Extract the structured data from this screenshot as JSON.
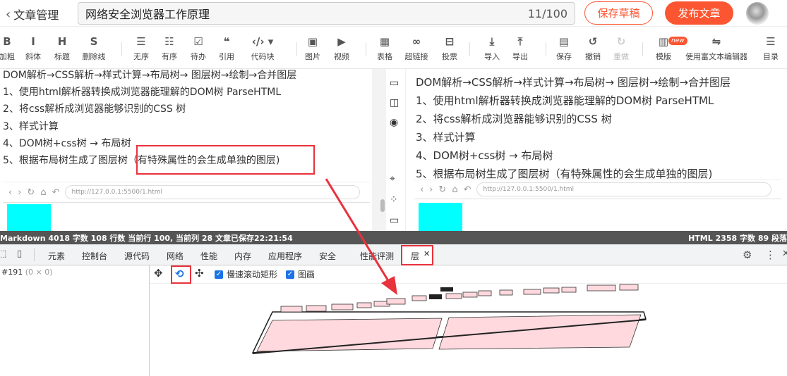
{
  "header": {
    "back_label": "文章管理",
    "title_value": "网络安全浏览器工作原理",
    "title_count": "11/100",
    "save_draft": "保存草稿",
    "publish": "发布文章"
  },
  "toolbar": {
    "items": [
      {
        "icon": "bold-icon",
        "glyph": "B",
        "label": "加粗"
      },
      {
        "icon": "italic-icon",
        "glyph": "I",
        "label": "斜体"
      },
      {
        "icon": "heading-icon",
        "glyph": "H",
        "label": "标题"
      },
      {
        "icon": "strikethrough-icon",
        "glyph": "S",
        "label": "删除线"
      },
      {
        "icon": "unordered-list-icon",
        "glyph": "☰",
        "label": "无序"
      },
      {
        "icon": "ordered-list-icon",
        "glyph": "☷",
        "label": "有序"
      },
      {
        "icon": "todo-list-icon",
        "glyph": "☑",
        "label": "待办"
      },
      {
        "icon": "quote-icon",
        "glyph": "❝",
        "label": "引用"
      },
      {
        "icon": "code-block-icon",
        "glyph": "‹/› ▾",
        "label": "代码块"
      },
      {
        "icon": "image-icon",
        "glyph": "▣",
        "label": "图片"
      },
      {
        "icon": "video-icon",
        "glyph": "▶",
        "label": "视频"
      },
      {
        "icon": "table-icon",
        "glyph": "▦",
        "label": "表格"
      },
      {
        "icon": "link-icon",
        "glyph": "∞",
        "label": "超链接"
      },
      {
        "icon": "vote-icon",
        "glyph": "⊟",
        "label": "投票"
      },
      {
        "icon": "import-icon",
        "glyph": "⤓",
        "label": "导入"
      },
      {
        "icon": "export-icon",
        "glyph": "⤒",
        "label": "导出"
      },
      {
        "icon": "save-icon",
        "glyph": "▤",
        "label": "保存"
      },
      {
        "icon": "undo-icon",
        "glyph": "↺",
        "label": "撤销"
      },
      {
        "icon": "redo-icon",
        "glyph": "↻",
        "label": "重做"
      },
      {
        "icon": "template-icon",
        "glyph": "▥",
        "label": "模版"
      },
      {
        "icon": "rich-editor-icon",
        "glyph": "⇋",
        "label": "使用富文本编辑器"
      },
      {
        "icon": "toc-icon",
        "glyph": "☰",
        "label": "目录"
      }
    ],
    "new_badge": "new"
  },
  "editor": {
    "lines": [
      "DOM解析→CSS解析→样式计算→布局树→ 图层树→绘制→合并图层",
      "1、使用html解析器转换成浏览器能理解的DOM树  ParseHTML",
      "2、将css解析成浏览器能够识别的CSS 树",
      "3、样式计算",
      "4、DOM树+css树 → 布局树",
      "5、根据布局树生成了图层树（有特殊属性的会生成单独的图层)"
    ],
    "mini_url": "http://127.0.0.1:5500/1.html"
  },
  "preview": {
    "lines": [
      "DOM解析→CSS解析→样式计算→布局树→ 图层树→绘制→合并图层",
      "1、使用html解析器转换成浏览器能理解的DOM树 ParseHTML",
      "2、将css解析成浏览器能够识别的CSS 树",
      "3、样式计算",
      "4、DOM树+css树 → 布局树",
      "5、根据布局树生成了图层树（有特殊属性的会生成单独的图层)"
    ],
    "mini_url": "http://127.0.0.1:5500/1.html"
  },
  "status": {
    "left": "Markdown  4018 字数  108 行数  当前行 100, 当前列 28  文章已保存22:21:54",
    "right": "HTML  2358 字数  89 段落"
  },
  "devtools": {
    "tabs": [
      "元素",
      "控制台",
      "源代码",
      "网络",
      "性能",
      "内存",
      "应用程序",
      "安全",
      "性能评测",
      "层"
    ],
    "active_tab": "层",
    "node_id": "#191",
    "node_size": "(0 × 0)",
    "slow_scroll_label": "慢速滚动矩形",
    "paint_label": "图画"
  },
  "colors": {
    "accent": "#fc5531",
    "highlight": "#e8323c",
    "cyan": "#00ffff",
    "status_bg": "#555555",
    "layer_fill": "#ffd9de"
  }
}
